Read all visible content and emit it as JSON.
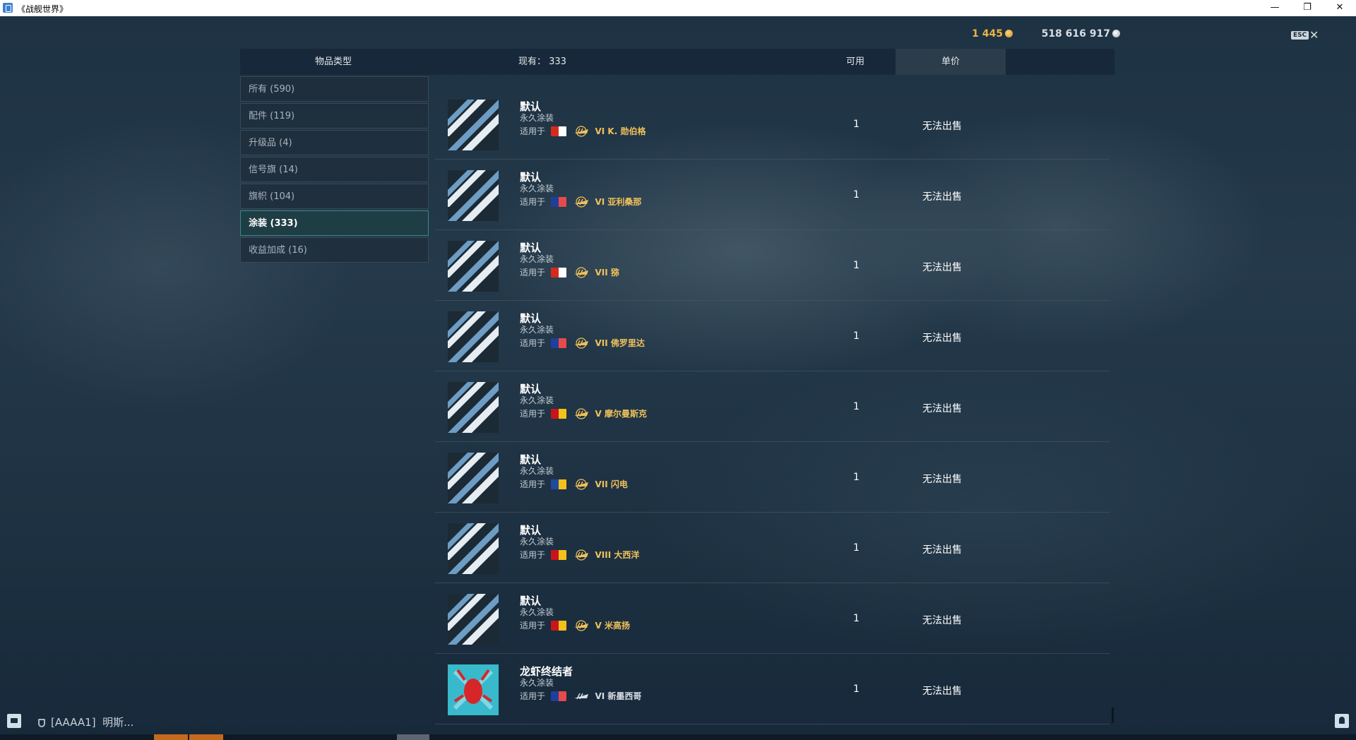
{
  "window": {
    "title": "《战舰世界》"
  },
  "currency": {
    "gold": "1 445",
    "credits": "518 616 917"
  },
  "esc": {
    "label": "ESC",
    "close": "✕"
  },
  "header": {
    "category": "物品类型",
    "owned": "现有：  333",
    "available": "可用",
    "unit_price": "单价"
  },
  "sidebar": {
    "items": [
      {
        "label": "所有 (590)",
        "selected": false
      },
      {
        "label": "配件 (119)",
        "selected": false
      },
      {
        "label": "升级品 (4)",
        "selected": false
      },
      {
        "label": "信号旗 (14)",
        "selected": false
      },
      {
        "label": "旗帜 (104)",
        "selected": false
      },
      {
        "label": "涂装 (333)",
        "selected": true
      },
      {
        "label": "收益加成 (16)",
        "selected": false
      }
    ]
  },
  "rows": [
    {
      "name": "默认",
      "type": "永久涂装",
      "applies_label": "适用于",
      "ship": "VI K. 勋伯格",
      "available": "1",
      "price": "无法出售",
      "flag": "germany",
      "premium": true,
      "icon": "destroyer-icon"
    },
    {
      "name": "默认",
      "type": "永久涂装",
      "applies_label": "适用于",
      "ship": "VI 亚利桑那",
      "available": "1",
      "price": "无法出售",
      "flag": "usa",
      "premium": true,
      "icon": "battleship-icon"
    },
    {
      "name": "默认",
      "type": "永久涂装",
      "applies_label": "适用于",
      "ship": "VII 猕",
      "available": "1",
      "price": "无法出售",
      "flag": "commonwealth",
      "premium": true,
      "icon": "destroyer-icon"
    },
    {
      "name": "默认",
      "type": "永久涂装",
      "applies_label": "适用于",
      "ship": "VII 佛罗里达",
      "available": "1",
      "price": "无法出售",
      "flag": "usa",
      "premium": true,
      "icon": "battleship-icon"
    },
    {
      "name": "默认",
      "type": "永久涂装",
      "applies_label": "适用于",
      "ship": "V 摩尔曼斯克",
      "available": "1",
      "price": "无法出售",
      "flag": "ussr",
      "premium": true,
      "icon": "cruiser-icon"
    },
    {
      "name": "默认",
      "type": "永久涂装",
      "applies_label": "适用于",
      "ship": "VII 闪电",
      "available": "1",
      "price": "无法出售",
      "flag": "europe",
      "premium": true,
      "icon": "destroyer-icon"
    },
    {
      "name": "默认",
      "type": "永久涂装",
      "applies_label": "适用于",
      "ship": "VIII 大西洋",
      "available": "1",
      "price": "无法出售",
      "flag": "spain",
      "premium": true,
      "icon": "battleship-icon"
    },
    {
      "name": "默认",
      "type": "永久涂装",
      "applies_label": "适用于",
      "ship": "V 米高扬",
      "available": "1",
      "price": "无法出售",
      "flag": "ussr",
      "premium": true,
      "icon": "cruiser-icon"
    },
    {
      "name": "龙虾终结者",
      "type": "永久涂装",
      "applies_label": "适用于",
      "ship": "VI 新墨西哥",
      "available": "1",
      "price": "无法出售",
      "flag": "usa",
      "premium": false,
      "icon": "battleship-icon"
    }
  ],
  "chat": {
    "clan": "[AAAA1]",
    "player": "明斯..."
  },
  "colors": {
    "accent_gold": "#f0c15a",
    "selected_border": "#3a8a87",
    "background": "#1c2e3d"
  }
}
